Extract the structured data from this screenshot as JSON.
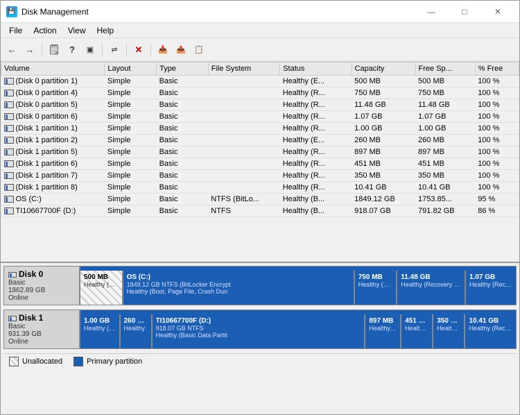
{
  "window": {
    "title": "Disk Management",
    "controls": {
      "minimize": "—",
      "maximize": "□",
      "close": "✕"
    }
  },
  "menu": {
    "items": [
      "File",
      "Action",
      "View",
      "Help"
    ]
  },
  "toolbar": {
    "buttons": [
      {
        "name": "back",
        "icon": "←"
      },
      {
        "name": "forward",
        "icon": "→"
      },
      {
        "name": "properties",
        "icon": "🗋"
      },
      {
        "name": "help",
        "icon": "?"
      },
      {
        "name": "disk-management",
        "icon": "⬜"
      },
      {
        "name": "connect",
        "icon": "🔌"
      },
      {
        "name": "delete",
        "icon": "✕",
        "red": true
      },
      {
        "name": "import",
        "icon": "📥"
      },
      {
        "name": "export",
        "icon": "📤"
      },
      {
        "name": "rescan",
        "icon": "🔄"
      }
    ]
  },
  "table": {
    "columns": [
      "Volume",
      "Layout",
      "Type",
      "File System",
      "Status",
      "Capacity",
      "Free Sp...",
      "% Free"
    ],
    "rows": [
      {
        "volume": "(Disk 0 partition 1)",
        "layout": "Simple",
        "type": "Basic",
        "fs": "",
        "status": "Healthy (E...",
        "capacity": "500 MB",
        "free": "500 MB",
        "pct": "100 %"
      },
      {
        "volume": "(Disk 0 partition 4)",
        "layout": "Simple",
        "type": "Basic",
        "fs": "",
        "status": "Healthy (R...",
        "capacity": "750 MB",
        "free": "750 MB",
        "pct": "100 %"
      },
      {
        "volume": "(Disk 0 partition 5)",
        "layout": "Simple",
        "type": "Basic",
        "fs": "",
        "status": "Healthy (R...",
        "capacity": "11.48 GB",
        "free": "11.48 GB",
        "pct": "100 %"
      },
      {
        "volume": "(Disk 0 partition 6)",
        "layout": "Simple",
        "type": "Basic",
        "fs": "",
        "status": "Healthy (R...",
        "capacity": "1.07 GB",
        "free": "1.07 GB",
        "pct": "100 %"
      },
      {
        "volume": "(Disk 1 partition 1)",
        "layout": "Simple",
        "type": "Basic",
        "fs": "",
        "status": "Healthy (R...",
        "capacity": "1.00 GB",
        "free": "1.00 GB",
        "pct": "100 %"
      },
      {
        "volume": "(Disk 1 partition 2)",
        "layout": "Simple",
        "type": "Basic",
        "fs": "",
        "status": "Healthy (E...",
        "capacity": "260 MB",
        "free": "260 MB",
        "pct": "100 %"
      },
      {
        "volume": "(Disk 1 partition 5)",
        "layout": "Simple",
        "type": "Basic",
        "fs": "",
        "status": "Healthy (R...",
        "capacity": "897 MB",
        "free": "897 MB",
        "pct": "100 %"
      },
      {
        "volume": "(Disk 1 partition 6)",
        "layout": "Simple",
        "type": "Basic",
        "fs": "",
        "status": "Healthy (R...",
        "capacity": "451 MB",
        "free": "451 MB",
        "pct": "100 %"
      },
      {
        "volume": "(Disk 1 partition 7)",
        "layout": "Simple",
        "type": "Basic",
        "fs": "",
        "status": "Healthy (R...",
        "capacity": "350 MB",
        "free": "350 MB",
        "pct": "100 %"
      },
      {
        "volume": "(Disk 1 partition 8)",
        "layout": "Simple",
        "type": "Basic",
        "fs": "",
        "status": "Healthy (R...",
        "capacity": "10.41 GB",
        "free": "10.41 GB",
        "pct": "100 %"
      },
      {
        "volume": "OS (C:)",
        "layout": "Simple",
        "type": "Basic",
        "fs": "NTFS (BitLo...",
        "status": "Healthy (B...",
        "capacity": "1849.12 GB",
        "free": "1753.85...",
        "pct": "95 %"
      },
      {
        "volume": "TI10667700F (D:)",
        "layout": "Simple",
        "type": "Basic",
        "fs": "NTFS",
        "status": "Healthy (B...",
        "capacity": "918.07 GB",
        "free": "791.82 GB",
        "pct": "86 %"
      }
    ]
  },
  "disks": [
    {
      "name": "Disk 0",
      "type": "Basic",
      "size": "1862.89 GB",
      "status": "Online",
      "partitions": [
        {
          "label": "500 MB",
          "sublabel": "Healthy (EFI S",
          "width": 8,
          "style": "hatch"
        },
        {
          "label": "OS (C:)",
          "sublabel": "1849.12 GB NTFS (BitLocker Encrypt\nHealthy (Boot, Page File, Crash Dun",
          "width": 52,
          "style": "blue"
        },
        {
          "label": "750 MB",
          "sublabel": "Healthy (Recov",
          "width": 8,
          "style": "primary"
        },
        {
          "label": "11.48 GB",
          "sublabel": "Healthy (Recovery Par",
          "width": 14,
          "style": "primary"
        },
        {
          "label": "1.07 GB",
          "sublabel": "Healthy (Recove",
          "width": 10,
          "style": "primary"
        }
      ]
    },
    {
      "name": "Disk 1",
      "type": "Basic",
      "size": "931.39 GB",
      "status": "Online",
      "partitions": [
        {
          "label": "1.00 GB",
          "sublabel": "Healthy (Re",
          "width": 8,
          "style": "primary"
        },
        {
          "label": "260 MB",
          "sublabel": "Healthy",
          "width": 6,
          "style": "primary"
        },
        {
          "label": "TI10667700F (D:)",
          "sublabel": "918.07 GB NTFS\nHealthy (Basic Data Partit",
          "width": 52,
          "style": "blue"
        },
        {
          "label": "897 MB",
          "sublabel": "Healthy (Re",
          "width": 7,
          "style": "primary"
        },
        {
          "label": "451 MB",
          "sublabel": "Healthy (I",
          "width": 6,
          "style": "primary"
        },
        {
          "label": "350 MB",
          "sublabel": "Healthy (",
          "width": 6,
          "style": "primary"
        },
        {
          "label": "10.41 GB",
          "sublabel": "Healthy (Recove",
          "width": 11,
          "style": "primary"
        }
      ]
    }
  ],
  "legend": {
    "items": [
      {
        "name": "Unallocated",
        "style": "unalloc"
      },
      {
        "name": "Primary partition",
        "style": "primary"
      }
    ]
  },
  "colors": {
    "primary_partition": "#1a5fb4",
    "accent": "#0078d4"
  }
}
